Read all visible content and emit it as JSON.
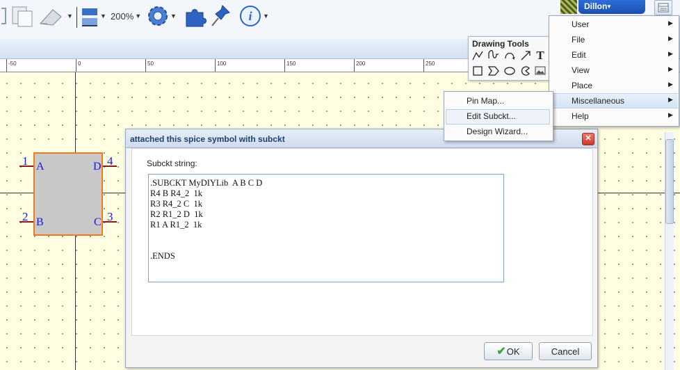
{
  "toolbar": {
    "zoom_label": "200%"
  },
  "ruler": {
    "labels": [
      "-50",
      "0",
      "50",
      "100",
      "150",
      "200",
      "250"
    ]
  },
  "symbol": {
    "pins": [
      {
        "number": "1",
        "name": "A"
      },
      {
        "number": "2",
        "name": "B"
      },
      {
        "number": "3",
        "name": "C"
      },
      {
        "number": "4",
        "name": "D"
      }
    ],
    "colors": {
      "body": "#c8c8c8",
      "border": "#f07a1a",
      "pin_text": "#1a1ae0",
      "pin_line": "#8b1a1a"
    }
  },
  "dialog": {
    "title": "attached this spice symbol with subckt",
    "field_label": "Subckt string:",
    "subckt_text": ".SUBCKT MyDIYLib  A B C D\nR4 B R4_2  1k\nR3 R4_2 C  1k\nR2 R1_2 D  1k\nR1 A R1_2  1k\n\n\n.ENDS",
    "ok_label": "OK",
    "cancel_label": "Cancel",
    "close_glyph": "✕"
  },
  "drawing_tools": {
    "title": "Drawing Tools",
    "tools": [
      "polyline-icon",
      "wire-icon",
      "arc-icon",
      "arrow-icon",
      "text-icon",
      "rectangle-icon",
      "polygon-icon",
      "ellipse-icon",
      "image-icon",
      "pie-icon"
    ],
    "text_tool_glyph": "T"
  },
  "user": {
    "name": "Dillon"
  },
  "main_menu": {
    "items": [
      {
        "label": "User"
      },
      {
        "label": "File"
      },
      {
        "label": "Edit"
      },
      {
        "label": "View"
      },
      {
        "label": "Place"
      },
      {
        "label": "Miscellaneous"
      },
      {
        "label": "Help"
      }
    ],
    "selected": "Miscellaneous"
  },
  "sub_menu": {
    "items": [
      {
        "label": "Pin Map..."
      },
      {
        "label": "Edit Subckt..."
      },
      {
        "label": "Design Wizard..."
      }
    ],
    "highlighted": "Edit Subckt..."
  }
}
